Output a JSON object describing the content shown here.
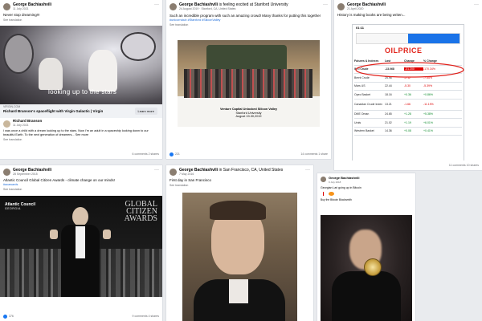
{
  "posts": [
    {
      "author": "George Bachiashvili",
      "date": "11 July 2021",
      "text": "Never stop dreaming!!!",
      "translation": "See translation",
      "image_caption": "looking up to the stars",
      "link_domain": "VIRGIN.COM",
      "link_title": "Richard Branson's spaceflight with Virgin Galactic | Virgin",
      "link_button": "Learn more",
      "shared_author": "Richard Branson",
      "shared_date": "11 July 2021",
      "shared_text": "I was once a child with a dream looking up to the stars. Now I'm an adult in a spaceship looking down to our beautiful Earth. To the next generation of dreamers... See more",
      "shared_translation": "See translation",
      "stats": "6 comments  2 shares"
    },
    {
      "author": "George Bachiashvili",
      "author_suffix": "is feeling excited at Stanford University",
      "date": "24 August 2019 · Stanford, CA, United States",
      "text": "Such an incredible program with such an amazing crowd! Many thanks for putting this together",
      "hashtags": "#unicornclub #Stanford #SiliconValley",
      "translation": "See translation",
      "caption_lines": [
        "Venture Capital Unlocked Silicon Valley",
        "Stanford University",
        "August 19-30,2019"
      ],
      "reactions": "221",
      "stats": "14 comments  1 share"
    },
    {
      "author": "George Bachiashvili",
      "date": "21 April 2020",
      "text": "History is making books are being writen...",
      "clock": "01:11",
      "brand": "OILPRICE",
      "table_headers": [
        "Futures & Indexes",
        "Last",
        "Change",
        "% Change"
      ],
      "table_rows": [
        [
          "WTI Crude",
          "-13.068",
          "-31.200",
          "-170.34%"
        ],
        [
          "Brent Crude",
          "25.96",
          "-2.12",
          "-7.55%"
        ],
        [
          "Mars US",
          "22.44",
          "-5.30",
          "-5.39%"
        ],
        [
          "Opec Basket",
          "18.16",
          "+0.36",
          "+0.86%"
        ],
        [
          "Canadian Crude Index",
          "13.21",
          "-1.66",
          "-11.19%"
        ],
        [
          "DME Oman",
          "24.65",
          "+1.28",
          "+5.38%"
        ],
        [
          "Urals",
          "21.02",
          "+1.19",
          "+6.01%"
        ],
        [
          "Western Basket",
          "14.36",
          "+0.08",
          "+0.41%"
        ]
      ],
      "stats": "11 comments  10 shares"
    },
    {
      "author": "George Bachiashvili",
      "date": "28 September 2015",
      "text": "Atlantic Council Global Citizen Awards - climate change on our minds!",
      "hashtags": "#acawards",
      "translation": "See translation",
      "ac_logo": "Atlantic Council",
      "ac_sub": "GEORGIA",
      "award_line1": "GLOBAL",
      "award_line2": "CITIZEN",
      "award_line3": "AWARDS",
      "reactions": "376",
      "stats": "9 comments  4 shares"
    },
    {
      "author": "George Bachiashvili",
      "author_suffix": "in San Francisco, CA, United States",
      "date": "7 May 2016",
      "text": "First day in San Francisco",
      "translation": "See translation"
    },
    {
      "author": "George Bachiashvili",
      "date": "9 July 2018",
      "text": "Georgian Lari going up in Bitcoin",
      "sub_text": "Buy the Bitcoin Blocksmith"
    }
  ]
}
